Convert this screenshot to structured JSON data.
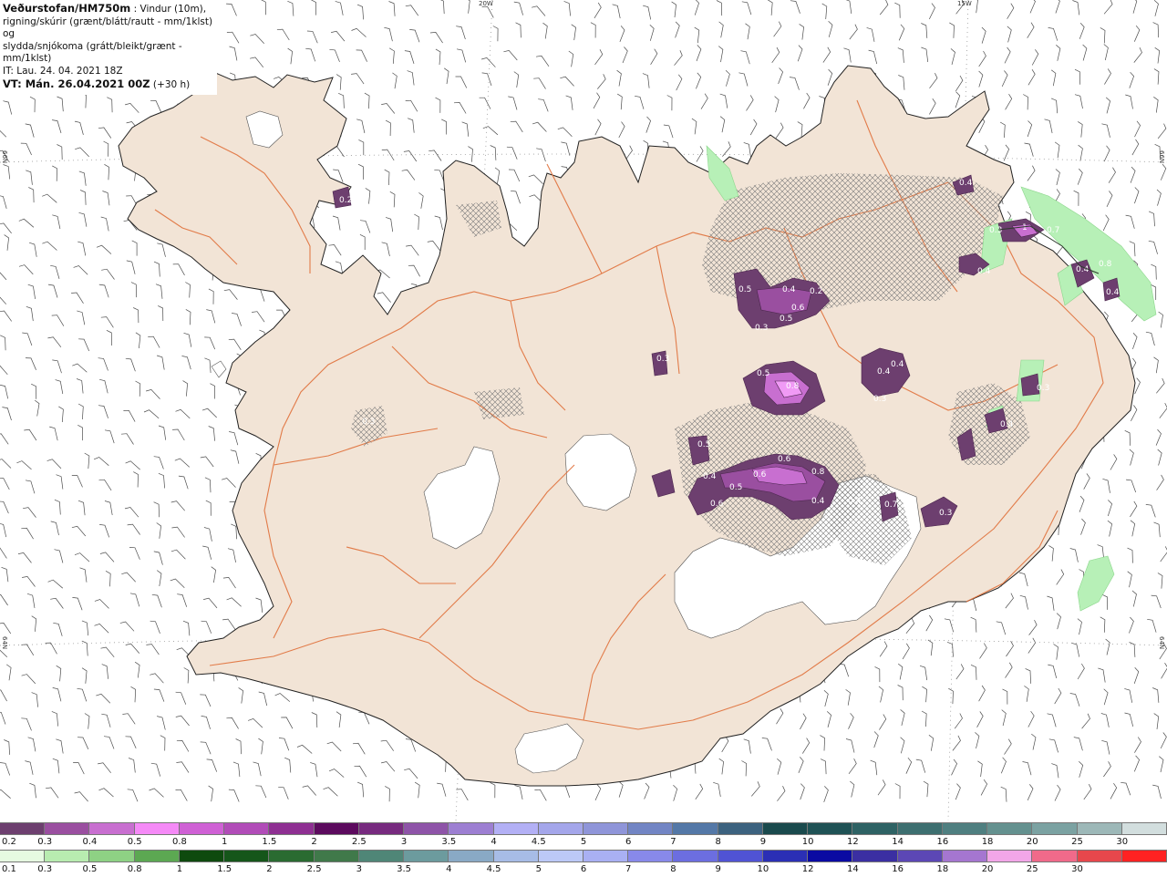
{
  "header": {
    "source": "Veðurstofan/HM750m",
    "line1_rest": " : Vindur (10m),",
    "line2": "rigning/skúrir (grænt/blátt/rautt - mm/1klst) og",
    "line3": "slydda/snjókoma (grátt/bleikt/grænt - mm/1klst)",
    "it": "IT: Lau. 24. 04. 2021 18Z",
    "vt_label": "VT: Mán. 26.04.2021 00Z",
    "vt_offset": " (+30 h)"
  },
  "grid_labels": {
    "lon_20w": "20W",
    "lon_15w": "15W",
    "lat_66n_left": "66N",
    "lat_66n_right": "66N",
    "lat_64n_left": "64N",
    "lat_64n_right": "64N"
  },
  "map": {
    "land_color": "#f2e4d6",
    "glacier_color": "#ffffff",
    "road_color": "#e0703a",
    "snow_colors": [
      "#6d3f6f",
      "#9a4fa0",
      "#c86fd0",
      "#f09af5"
    ],
    "rain_color": "#b7f0b7",
    "precip_values": [
      "0.5",
      "0.4",
      "0.6",
      "0.2",
      "0.5",
      "0.3",
      "0.5",
      "0.8",
      "0.4",
      "0.4",
      "0.3",
      "0.5",
      "0.4",
      "0.5",
      "0.6",
      "0.6",
      "0.6",
      "0.8",
      "0.4",
      "0.4",
      "0.7",
      "0.3",
      "0.3",
      "0.2",
      "0.3",
      "0.4",
      "0.3",
      "0.4",
      "0.3",
      "0.4",
      "1",
      "0.7",
      "0.8",
      "0.4",
      "0.4"
    ]
  },
  "legend_snow": {
    "labels": [
      "0.2",
      "0.3",
      "0.4",
      "0.5",
      "0.8",
      "1",
      "1.5",
      "2",
      "2.5",
      "3",
      "3.5",
      "4",
      "4.5",
      "5",
      "6",
      "7",
      "8",
      "9",
      "10",
      "12",
      "14",
      "16",
      "18",
      "20",
      "25",
      "30"
    ],
    "colors": [
      "#6d3f6f",
      "#9a4fa0",
      "#c86fd0",
      "#f58af7",
      "#cf61d5",
      "#b14cb8",
      "#8e2f92",
      "#5c0a5e",
      "#772a7f",
      "#8e54a8",
      "#9d7fd2",
      "#b3b0f5",
      "#a4a6ea",
      "#8f95d9",
      "#7285c4",
      "#5478a7",
      "#3c627f",
      "#1a4a4d",
      "#1f5255",
      "#2e6264",
      "#3d6f70",
      "#4f7f80",
      "#64918f",
      "#7ba2a2",
      "#9db8b8",
      "#d2dede"
    ]
  },
  "legend_rain": {
    "labels": [
      "0.1",
      "0.3",
      "0.5",
      "0.8",
      "1",
      "1.5",
      "2",
      "2.5",
      "3",
      "3.5",
      "4",
      "4.5",
      "5",
      "6",
      "7",
      "8",
      "9",
      "10",
      "12",
      "14",
      "16",
      "18",
      "20",
      "25",
      "30"
    ],
    "colors": [
      "#e6fbe1",
      "#b8ecb0",
      "#8ed184",
      "#5ca852",
      "#0e4a0e",
      "#15561a",
      "#2a6b31",
      "#40794a",
      "#4f8677",
      "#6c9b9e",
      "#89a9c5",
      "#a7bce6",
      "#bcc9f7",
      "#a9b0f3",
      "#8889ea",
      "#6c6ee0",
      "#5053d4",
      "#2b2fb5",
      "#0a0aa2",
      "#3b2fa2",
      "#5c47b5",
      "#a576d0",
      "#f2a6e8",
      "#f06a8a",
      "#e7474c",
      "#ff2222"
    ]
  }
}
